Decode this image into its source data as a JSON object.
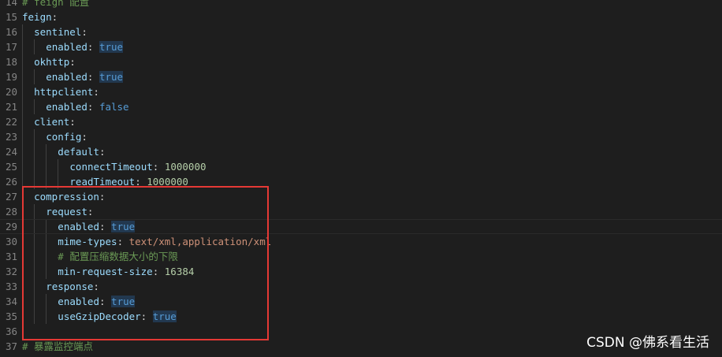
{
  "editor": {
    "lines": [
      {
        "num": "14",
        "indent": 0,
        "type": "comment",
        "text": "# feign 配置"
      },
      {
        "num": "15",
        "indent": 0,
        "type": "key",
        "key": "feign"
      },
      {
        "num": "16",
        "indent": 1,
        "type": "key",
        "key": "sentinel"
      },
      {
        "num": "17",
        "indent": 2,
        "type": "kv",
        "key": "enabled",
        "value": "true",
        "vtype": "bool-hl"
      },
      {
        "num": "18",
        "indent": 1,
        "type": "key",
        "key": "okhttp"
      },
      {
        "num": "19",
        "indent": 2,
        "type": "kv",
        "key": "enabled",
        "value": "true",
        "vtype": "bool-hl"
      },
      {
        "num": "20",
        "indent": 1,
        "type": "key",
        "key": "httpclient"
      },
      {
        "num": "21",
        "indent": 2,
        "type": "kv",
        "key": "enabled",
        "value": "false",
        "vtype": "bool"
      },
      {
        "num": "22",
        "indent": 1,
        "type": "key",
        "key": "client"
      },
      {
        "num": "23",
        "indent": 2,
        "type": "key",
        "key": "config"
      },
      {
        "num": "24",
        "indent": 3,
        "type": "key",
        "key": "default"
      },
      {
        "num": "25",
        "indent": 4,
        "type": "kv",
        "key": "connectTimeout",
        "value": "1000000",
        "vtype": "num"
      },
      {
        "num": "26",
        "indent": 4,
        "type": "kv",
        "key": "readTimeout",
        "value": "1000000",
        "vtype": "num"
      },
      {
        "num": "27",
        "indent": 1,
        "type": "key",
        "key": "compression"
      },
      {
        "num": "28",
        "indent": 2,
        "type": "key",
        "key": "request"
      },
      {
        "num": "29",
        "indent": 3,
        "type": "kv",
        "key": "enabled",
        "value": "true",
        "vtype": "bool-hl",
        "current": true
      },
      {
        "num": "30",
        "indent": 3,
        "type": "kv",
        "key": "mime-types",
        "value": "text/xml,application/xml",
        "vtype": "str"
      },
      {
        "num": "31",
        "indent": 3,
        "type": "comment",
        "text": "# 配置压缩数据大小的下限"
      },
      {
        "num": "32",
        "indent": 3,
        "type": "kv",
        "key": "min-request-size",
        "value": "16384",
        "vtype": "num"
      },
      {
        "num": "33",
        "indent": 2,
        "type": "key",
        "key": "response"
      },
      {
        "num": "34",
        "indent": 3,
        "type": "kv",
        "key": "enabled",
        "value": "true",
        "vtype": "bool-hl"
      },
      {
        "num": "35",
        "indent": 3,
        "type": "kv",
        "key": "useGzipDecoder",
        "value": "true",
        "vtype": "bool-hl"
      },
      {
        "num": "36",
        "indent": 0,
        "type": "blank"
      },
      {
        "num": "37",
        "indent": 0,
        "type": "comment",
        "text": "# 暴露监控端点"
      }
    ]
  },
  "watermark": "CSDN @佛系看生活",
  "colors": {
    "background": "#1e1e1e",
    "key": "#9cdcfe",
    "boolean": "#569cd6",
    "number": "#b5cea8",
    "string": "#ce9178",
    "comment": "#6a9955",
    "annotation_box": "#e53935"
  }
}
